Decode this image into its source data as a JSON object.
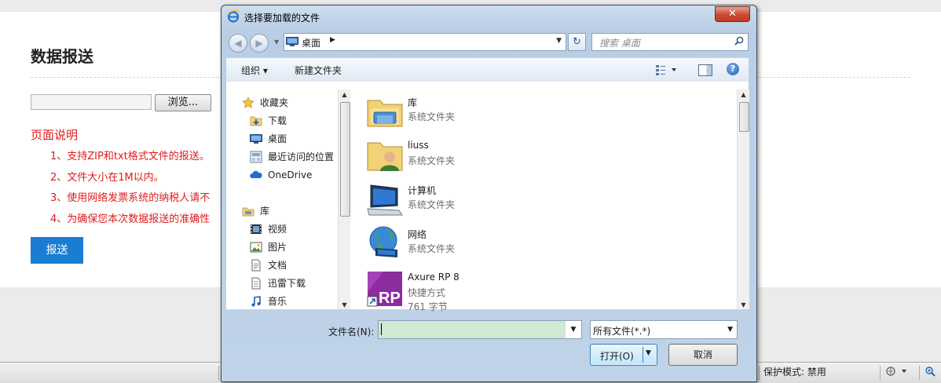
{
  "page": {
    "title": "数据报送",
    "browse_label": "浏览...",
    "desc_title": "页面说明",
    "desc_items": [
      "1、支持ZIP和txt格式文件的报送。",
      "2、文件大小在1M以内。",
      "3、使用网络发票系统的纳税人请不",
      "4、为确保您本次数据报送的准确性"
    ],
    "submit_label": "报送"
  },
  "statusbar": {
    "protected_mode": "保护模式: 禁用"
  },
  "dialog": {
    "title": "选择要加载的文件",
    "address": "桌面",
    "search_placeholder": "搜索 桌面",
    "toolbar": {
      "organize": "组织 ▾",
      "new_folder": "新建文件夹"
    },
    "nav_items": [
      {
        "label": "收藏夹",
        "icon": "star-icon"
      },
      {
        "label": "下载",
        "icon": "downloads-folder-icon"
      },
      {
        "label": "桌面",
        "icon": "desktop-icon"
      },
      {
        "label": "最近访问的位置",
        "icon": "recent-places-icon"
      },
      {
        "label": "OneDrive",
        "icon": "onedrive-icon"
      },
      {
        "label": "库",
        "icon": "library-icon"
      },
      {
        "label": "视频",
        "icon": "video-icon"
      },
      {
        "label": "图片",
        "icon": "pictures-icon"
      },
      {
        "label": "文档",
        "icon": "documents-icon"
      },
      {
        "label": "迅雷下载",
        "icon": "thunder-download-icon"
      },
      {
        "label": "音乐",
        "icon": "music-icon"
      }
    ],
    "files": [
      {
        "name": "库",
        "type": "系统文件夹",
        "icon": "library-folder-icon"
      },
      {
        "name": "liuss",
        "type": "系统文件夹",
        "icon": "user-folder-icon"
      },
      {
        "name": "计算机",
        "type": "系统文件夹",
        "icon": "computer-icon"
      },
      {
        "name": "网络",
        "type": "系统文件夹",
        "icon": "network-icon"
      },
      {
        "name": "Axure RP 8",
        "type": "快捷方式",
        "size": "761 字节",
        "icon": "axure-shortcut-icon"
      }
    ],
    "filename_label": "文件名(N):",
    "filename_value": "",
    "filter_value": "所有文件(*.*)",
    "open_label": "打开(O)",
    "cancel_label": "取消"
  },
  "colors": {
    "accent_red": "#e01b1b",
    "submit_blue": "#1a7dd4",
    "filename_bg": "#cfe9d3"
  }
}
